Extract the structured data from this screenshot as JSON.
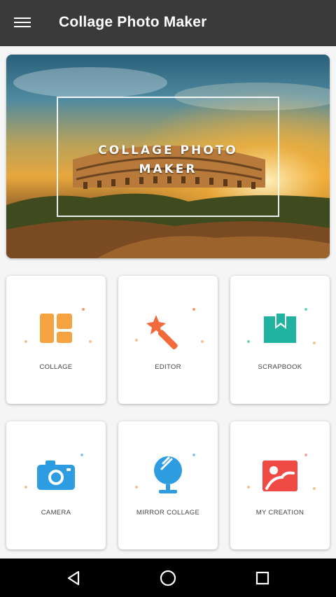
{
  "app_bar": {
    "title": "Collage Photo Maker",
    "menu_icon": "hamburger-menu-icon",
    "background": "#3a3a3a"
  },
  "banner": {
    "line1": "COLLAGE PHOTO",
    "line2": "MAKER"
  },
  "tiles": [
    {
      "label": "COLLAGE",
      "icon": "collage-icon",
      "color": "#f5a340"
    },
    {
      "label": "EDITOR",
      "icon": "magic-wand-icon",
      "color": "#f26a3a"
    },
    {
      "label": "SCRAPBOOK",
      "icon": "bookmark-book-icon",
      "color": "#22b2a0"
    },
    {
      "label": "CAMERA",
      "icon": "camera-icon",
      "color": "#2d9ce0"
    },
    {
      "label": "MIRROR COLLAGE",
      "icon": "mirror-icon",
      "color": "#2d9ce0"
    },
    {
      "label": "MY CREATION",
      "icon": "portrait-photo-icon",
      "color": "#f04a45"
    }
  ],
  "nav_bar": {
    "back_icon": "back-triangle-icon",
    "home_icon": "home-circle-icon",
    "recents_icon": "recents-square-icon"
  }
}
